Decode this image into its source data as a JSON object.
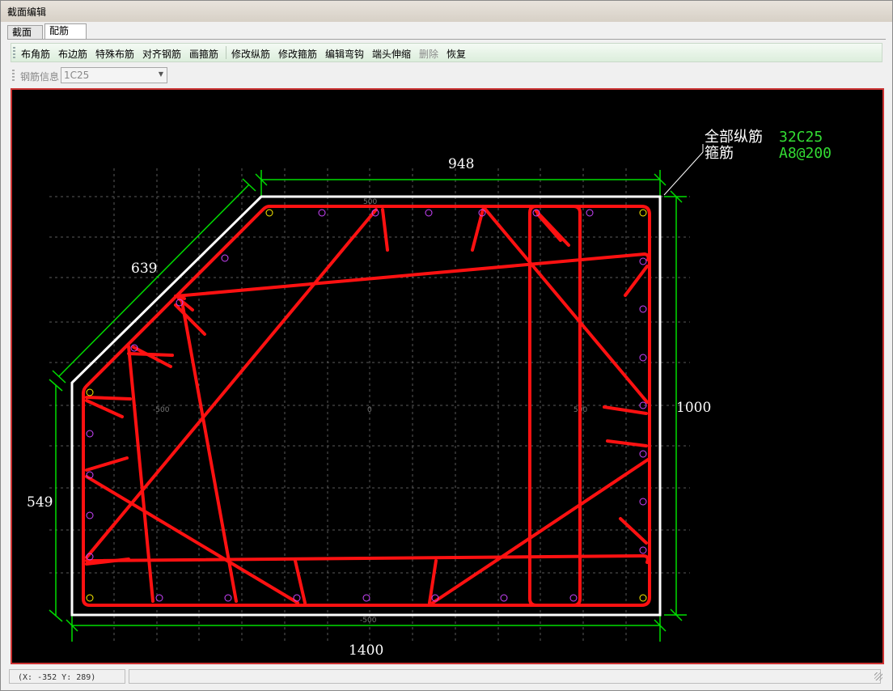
{
  "window": {
    "title": "截面编辑"
  },
  "tabs": [
    {
      "label": "截面",
      "active": false
    },
    {
      "label": "配筋",
      "active": true
    }
  ],
  "toolbar": {
    "buttons": [
      {
        "label": "布角筋",
        "enabled": true
      },
      {
        "label": "布边筋",
        "enabled": true
      },
      {
        "label": "特殊布筋",
        "enabled": true
      },
      {
        "label": "对齐钢筋",
        "enabled": true
      },
      {
        "label": "画箍筋",
        "enabled": true
      },
      {
        "label": "修改纵筋",
        "enabled": true
      },
      {
        "label": "修改箍筋",
        "enabled": true
      },
      {
        "label": "编辑弯钩",
        "enabled": true
      },
      {
        "label": "端头伸缩",
        "enabled": true
      },
      {
        "label": "删除",
        "enabled": false
      },
      {
        "label": "恢复",
        "enabled": true
      }
    ]
  },
  "rebar_info": {
    "label": "钢筋信息",
    "value": "1C25"
  },
  "drawing": {
    "dimensions": {
      "top": "948",
      "slope": "639",
      "left": "549",
      "right": "1000",
      "bottom": "1400"
    },
    "summary": [
      {
        "label": "全部纵筋",
        "value": "32C25"
      },
      {
        "label": "箍筋",
        "value": "A8@200"
      }
    ],
    "axis_labels": {
      "top": "500",
      "left": "-500",
      "center": "0",
      "right": "500",
      "bottom": "-500"
    },
    "rebar_marker": "25",
    "colors": {
      "background": "#000000",
      "dimension": "#00dd00",
      "outline": "#ffffff",
      "stirrup": "#ff1111",
      "rebar": "#cc44ff",
      "corner_rebar": "#ffee00",
      "summary_value": "#33dd33"
    }
  },
  "status": {
    "coords": "(X: -352 Y: 289)"
  }
}
